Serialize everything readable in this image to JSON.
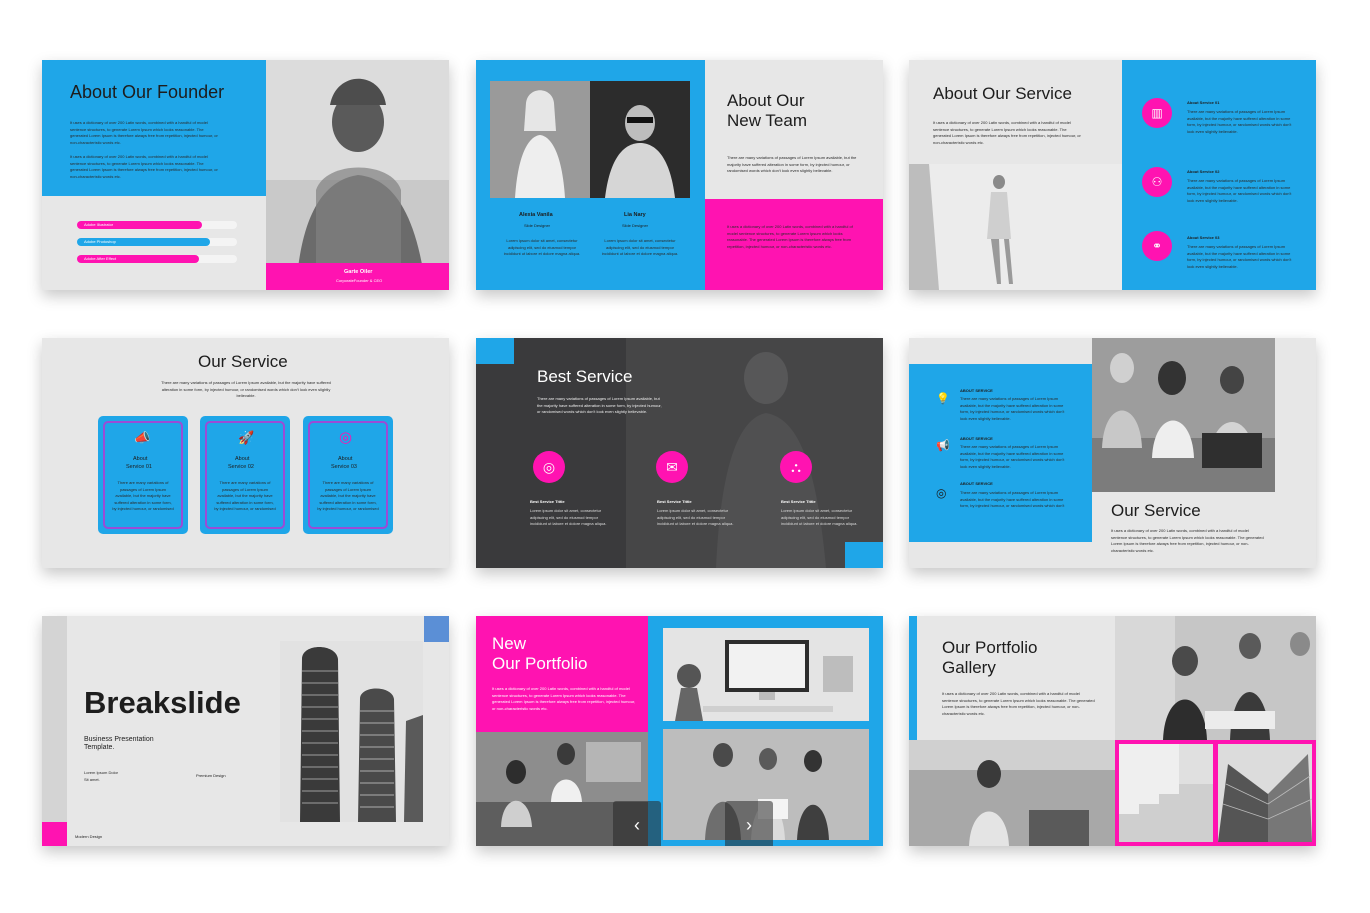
{
  "colors": {
    "blue": "#1fa6e8",
    "pink": "#ff13b1",
    "light": "#e7e7e7",
    "dark": "#3a3a3c"
  },
  "lorem": {
    "p1": "It uses a dictionary of over 200 Latin words, combined with a handful of model sentence structures, to generate Lorem Ipsum which looks reasonable. The generated Lorem Ipsum is therefore always free from repetition, injected humour, or non-characteristic words etc.",
    "p2": "There are many variations of passages of Lorem Ipsum available, but the majority have suffered alteration in some form, by injected humour, or randomised words which don't look even slightly believable.",
    "p3": "Lorem ipsum dolor sit amet, consectetur adipiscing elit, sed do eiusmod tempor incididunt ut labore et dolore magna aliqua."
  },
  "slide1": {
    "title": "About Our Founder",
    "bars": [
      "Adobe Illustrator",
      "Adobe Photoshop",
      "Adobe After Effect"
    ],
    "bar_levels": [
      0.78,
      0.83,
      0.76
    ],
    "person_name": "Garte Oiler",
    "person_role": "CorporateFounder & CEO"
  },
  "slide2": {
    "title_line1": "About Our",
    "title_line2": "New Team",
    "member1_name": "Alexia Vanila",
    "member1_role": "Slide Designer",
    "member2_name": "Lia Nary",
    "member2_role": "Slide Designer"
  },
  "slide3": {
    "title": "About Our Service",
    "items": [
      "About Service 01",
      "About Service 02",
      "About Service 03"
    ]
  },
  "slide4": {
    "title": "Our Service",
    "cards": [
      {
        "line1": "About",
        "line2": "Service 01",
        "icon": "megaphone-icon"
      },
      {
        "line1": "About",
        "line2": "Service 02",
        "icon": "rocket-icon"
      },
      {
        "line1": "About",
        "line2": "Service 03",
        "icon": "target-icon"
      }
    ]
  },
  "slide5": {
    "title": "Best Service",
    "items": [
      "Best Service Tittle",
      "Best Service Tittle",
      "Best Service Tittle"
    ]
  },
  "slide6": {
    "title": "Our Service",
    "items": [
      "ABOUT SERVICE",
      "ABOUT SERVICE",
      "ABOUT SERVICE"
    ]
  },
  "slide7": {
    "title": "Breakslide",
    "subtitle_line1": "Business Presentation",
    "subtitle_line2": "Template.",
    "small_text": "Lorem Ipsum Dolor Sit amet.",
    "premium": "Premium Design",
    "modern": "Modern Design"
  },
  "slide8": {
    "title_line1": "New",
    "title_line2": "Our Portfolio"
  },
  "slide9": {
    "title_line1": "Our Portfolio",
    "title_line2": "Gallery"
  },
  "nav": {
    "prev": "‹",
    "next": "›"
  }
}
